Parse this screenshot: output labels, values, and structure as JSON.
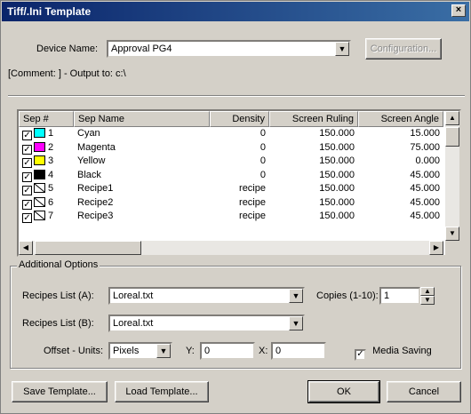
{
  "window": {
    "title": "Tiff/.Ini Template",
    "close": "×"
  },
  "device": {
    "label": "Device Name:",
    "value": "Approval PG4",
    "config_button": "Configuration..."
  },
  "comment": "[Comment: ] - Output to: c:\\",
  "table": {
    "headers": [
      "Sep #",
      "Sep Name",
      "Density",
      "Screen Ruling",
      "Screen Angle"
    ],
    "rows": [
      {
        "num": "1",
        "checked": true,
        "swatch": "#00ffff",
        "name": "Cyan",
        "density": "0",
        "ruling": "150.000",
        "angle": "15.000"
      },
      {
        "num": "2",
        "checked": true,
        "swatch": "#ff00ff",
        "name": "Magenta",
        "density": "0",
        "ruling": "150.000",
        "angle": "75.000"
      },
      {
        "num": "3",
        "checked": true,
        "swatch": "#ffff00",
        "name": "Yellow",
        "density": "0",
        "ruling": "150.000",
        "angle": "0.000"
      },
      {
        "num": "4",
        "checked": true,
        "swatch": "#000000",
        "name": "Black",
        "density": "0",
        "ruling": "150.000",
        "angle": "45.000"
      },
      {
        "num": "5",
        "checked": true,
        "swatch": "none",
        "name": "Recipe1",
        "density": "recipe",
        "ruling": "150.000",
        "angle": "45.000"
      },
      {
        "num": "6",
        "checked": true,
        "swatch": "none",
        "name": "Recipe2",
        "density": "recipe",
        "ruling": "150.000",
        "angle": "45.000"
      },
      {
        "num": "7",
        "checked": true,
        "swatch": "none",
        "name": "Recipe3",
        "density": "recipe",
        "ruling": "150.000",
        "angle": "45.000"
      }
    ]
  },
  "options": {
    "group_title": "Additional Options",
    "recipes_a_label": "Recipes List (A):",
    "recipes_a_value": "Loreal.txt",
    "copies_label": "Copies (1-10):",
    "copies_value": "1",
    "recipes_b_label": "Recipes List (B):",
    "recipes_b_value": "Loreal.txt",
    "offset_label": "Offset - Units:",
    "offset_value": "Pixels",
    "y_label": "Y:",
    "y_value": "0",
    "x_label": "X:",
    "x_value": "0",
    "media_saving_label": "Media Saving",
    "media_saving_checked": true
  },
  "buttons": {
    "save": "Save Template...",
    "load": "Load Template...",
    "ok": "OK",
    "cancel": "Cancel"
  },
  "icons": {
    "dropdown": "chevron-down-icon",
    "check": "checkmark-icon",
    "close": "close-icon"
  }
}
